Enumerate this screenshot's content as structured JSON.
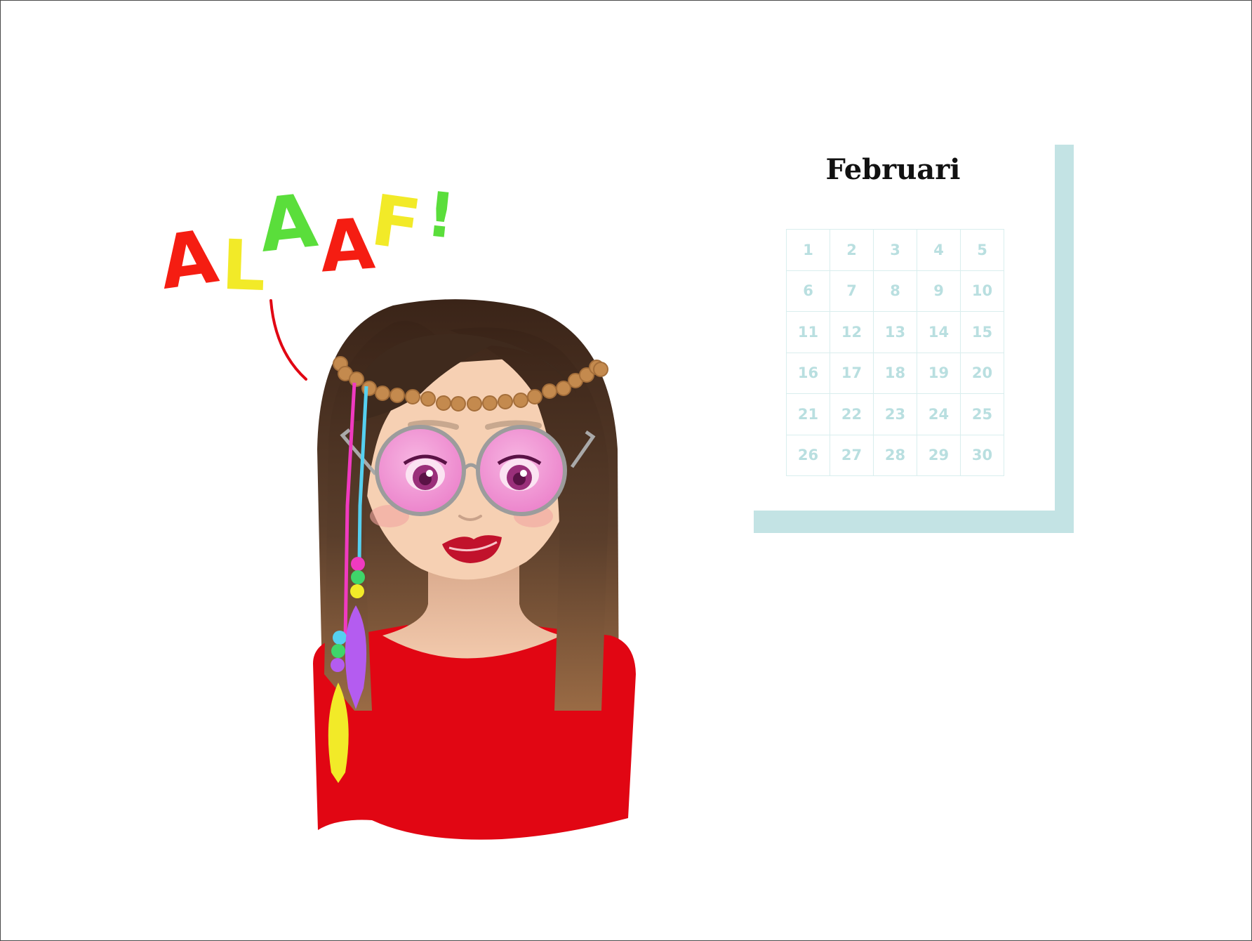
{
  "exclamation": {
    "letters": [
      {
        "char": "A",
        "color": "#f51d12"
      },
      {
        "char": "L",
        "color": "#f2ea28"
      },
      {
        "char": "A",
        "color": "#5ade3b"
      },
      {
        "char": "A",
        "color": "#f51d12"
      },
      {
        "char": "F",
        "color": "#f2ea28"
      },
      {
        "char": "!",
        "color": "#5ade3b"
      }
    ]
  },
  "calendar": {
    "month": "Februari",
    "days": [
      "1",
      "2",
      "3",
      "4",
      "5",
      "6",
      "7",
      "8",
      "9",
      "10",
      "11",
      "12",
      "13",
      "14",
      "15",
      "16",
      "17",
      "18",
      "19",
      "20",
      "21",
      "22",
      "23",
      "24",
      "25",
      "26",
      "27",
      "28",
      "29",
      "30"
    ]
  },
  "colors": {
    "accent_bar": "#c3e3e4",
    "shirt": "#e10613",
    "lens": "#f08fd0",
    "hair": "#4a3324"
  }
}
